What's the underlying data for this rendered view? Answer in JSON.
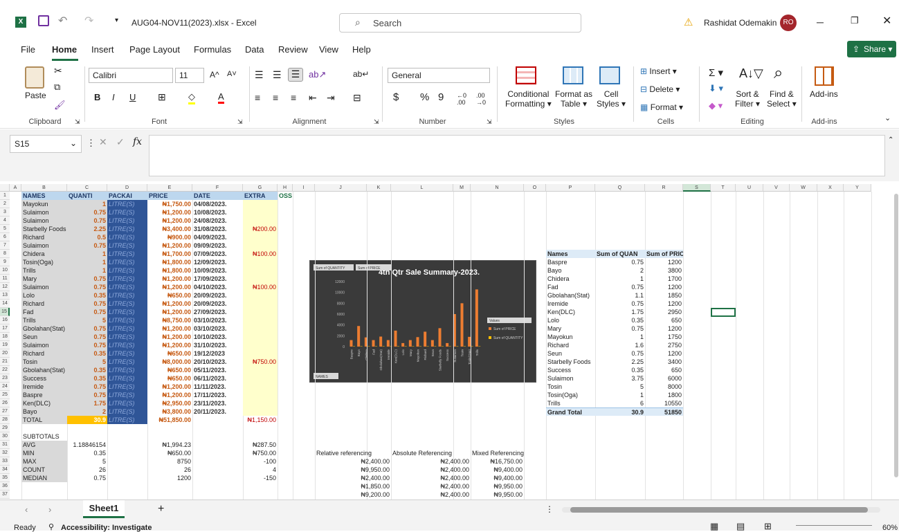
{
  "title_bar": {
    "app_icon": "X",
    "filename": "AUG04-NOV11(2023).xlsx",
    "app": "Excel",
    "sep": "-",
    "search_placeholder": "Search",
    "user": "Rashidat Odemakin",
    "initials": "RO"
  },
  "menus": [
    "File",
    "Home",
    "Insert",
    "Page Layout",
    "Formulas",
    "Data",
    "Review",
    "View",
    "Help"
  ],
  "share_label": "Share",
  "ribbon": {
    "clipboard": {
      "paste": "Paste",
      "label": "Clipboard"
    },
    "font": {
      "name": "Calibri",
      "size": "11",
      "bold": "B",
      "italic": "I",
      "underline": "U",
      "label": "Font",
      "grow": "A^",
      "shrink": "A˅"
    },
    "alignment": {
      "label": "Alignment"
    },
    "number": {
      "format": "General",
      "currency": "$",
      "percent": "%",
      "comma": "9",
      "label": "Number"
    },
    "styles": {
      "cond1": "Conditional",
      "cond2": "Formatting",
      "fmt1": "Format as",
      "fmt2": "Table",
      "cell1": "Cell",
      "cell2": "Styles",
      "label": "Styles"
    },
    "cells": {
      "insert": "Insert",
      "delete": "Delete",
      "format": "Format",
      "label": "Cells"
    },
    "editing": {
      "sort1": "Sort &",
      "sort2": "Filter",
      "find1": "Find &",
      "find2": "Select",
      "label": "Editing"
    },
    "addins": {
      "btn": "Add-ins",
      "label": "Add-ins"
    }
  },
  "formula_bar": {
    "name_box": "S15",
    "fx": "fx",
    "value": ""
  },
  "columns": [
    "A",
    "B",
    "C",
    "D",
    "E",
    "F",
    "G",
    "H",
    "I",
    "J",
    "K",
    "L",
    "M",
    "N",
    "O",
    "P",
    "Q",
    "R",
    "S",
    "T",
    "U",
    "V",
    "W",
    "X",
    "Y"
  ],
  "table_headers": [
    "NAMES",
    "QUANTI",
    "PACKAI",
    "PRICE",
    "DATE",
    "EXTRA",
    "OSS"
  ],
  "rows": [
    [
      "Mayokun",
      "1",
      "LITRE(S)",
      "₦1,750.00",
      "04/08/2023.",
      ""
    ],
    [
      "Sulaimon",
      "0.75",
      "LITRE(S)",
      "₦1,200.00",
      "10/08/2023.",
      ""
    ],
    [
      "Sulaimon",
      "0.75",
      "LITRE(S)",
      "₦1,200.00",
      "24/08/2023.",
      ""
    ],
    [
      "Starbelly Foods",
      "2.25",
      "LITRE(S)",
      "₦3,400.00",
      "31/08/2023.",
      "₦200.00"
    ],
    [
      "Richard",
      "0.5",
      "LITRE(S)",
      "₦900.00",
      "04/09/2023.",
      ""
    ],
    [
      "Sulaimon",
      "0.75",
      "LITRE(S)",
      "₦1,200.00",
      "09/09/2023.",
      ""
    ],
    [
      "Chidera",
      "1",
      "LITRE(S)",
      "₦1,700.00",
      "07/09/2023.",
      "₦100.00"
    ],
    [
      "Tosin(Oga)",
      "1",
      "LITRE(S)",
      "₦1,800.00",
      "12/09/2023.",
      ""
    ],
    [
      "Trills",
      "1",
      "LITRE(S)",
      "₦1,800.00",
      "10/09/2023.",
      ""
    ],
    [
      "Mary",
      "0.75",
      "LITRE(S)",
      "₦1,200.00",
      "17/09/2023.",
      ""
    ],
    [
      "Sulaimon",
      "0.75",
      "LITRE(S)",
      "₦1,200.00",
      "04/10/2023.",
      "₦100.00"
    ],
    [
      "Lolo",
      "0.35",
      "LITRE(S)",
      "₦650.00",
      "20/09/2023.",
      ""
    ],
    [
      "Richard",
      "0.75",
      "LITRE(S)",
      "₦1,200.00",
      "20/09/2023.",
      ""
    ],
    [
      "Fad",
      "0.75",
      "LITRE(S)",
      "₦1,200.00",
      "27/09/2023.",
      ""
    ],
    [
      "Trills",
      "5",
      "LITRE(S)",
      "₦8,750.00",
      "03/10/2023.",
      ""
    ],
    [
      "Gbolahan(Stat)",
      "0.75",
      "LITRE(S)",
      "₦1,200.00",
      "03/10/2023.",
      ""
    ],
    [
      "Seun",
      "0.75",
      "LITRE(S)",
      "₦1,200.00",
      "10/10/2023.",
      ""
    ],
    [
      "Sulaimon",
      "0.75",
      "LITRE(S)",
      "₦1,200.00",
      "31/10/2023.",
      ""
    ],
    [
      "Richard",
      "0.35",
      "LITRE(S)",
      "₦650.00",
      "19/12/2023",
      ""
    ],
    [
      "Tosin",
      "5",
      "LITRE(S)",
      "₦8,000.00",
      "20/10/2023.",
      "₦750.00"
    ],
    [
      "Gbolahan(Stat)",
      "0.35",
      "LITRE(S)",
      "₦650.00",
      "05/11/2023.",
      ""
    ],
    [
      "Success",
      "0.35",
      "LITRE(S)",
      "₦650.00",
      "06/11/2023.",
      ""
    ],
    [
      "Iremide",
      "0.75",
      "LITRE(S)",
      "₦1,200.00",
      "11/11/2023.",
      ""
    ],
    [
      "Baspre",
      "0.75",
      "LITRE(S)",
      "₦1,200.00",
      "17/11/2023.",
      ""
    ],
    [
      "Ken(DLC)",
      "1.75",
      "LITRE(S)",
      "₦2,950.00",
      "23/11/2023.",
      ""
    ],
    [
      "Bayo",
      "2",
      "LITRE(S)",
      "₦3,800.00",
      "20/11/2023.",
      ""
    ]
  ],
  "total_row": [
    "TOTAL",
    "30.9",
    "LITRE(S)",
    "₦51,850.00",
    "",
    "₦1,150.00"
  ],
  "subtotals": {
    "title": "SUBTOTALS",
    "rows": [
      [
        "AVG",
        "1.18846154",
        "₦1,994.23",
        "",
        "₦287.50"
      ],
      [
        "MIN",
        "0.35",
        "₦650.00",
        "",
        "₦750.00"
      ],
      [
        "MAX",
        "5",
        "8750",
        "",
        "-100"
      ],
      [
        "COUNT",
        "26",
        "26",
        "",
        "4"
      ],
      [
        "MEDIAN",
        "0.75",
        "1200",
        "",
        "-150"
      ]
    ]
  },
  "referencing": {
    "headers": [
      "Relative referencing",
      "Absolute Referencing",
      "Mixed Referencing"
    ],
    "rows": [
      [
        "₦2,400.00",
        "₦2,400.00",
        "₦16,750.00"
      ],
      [
        "₦9,950.00",
        "₦2,400.00",
        "₦9,400.00"
      ],
      [
        "₦2,400.00",
        "₦2,400.00",
        "₦9,400.00"
      ],
      [
        "₦1,850.00",
        "₦2,400.00",
        "₦9,950.00"
      ],
      [
        "₦9,200.00",
        "₦2,400.00",
        "₦9,950.00"
      ]
    ]
  },
  "pivot": {
    "headers": [
      "Names",
      "Sum of QUAN",
      "Sum of PRICE"
    ],
    "rows": [
      [
        "Baspre",
        "0.75",
        "1200"
      ],
      [
        "Bayo",
        "2",
        "3800"
      ],
      [
        "Chidera",
        "1",
        "1700"
      ],
      [
        "Fad",
        "0.75",
        "1200"
      ],
      [
        "Gbolahan(Stat)",
        "1.1",
        "1850"
      ],
      [
        "Iremide",
        "0.75",
        "1200"
      ],
      [
        "Ken(DLC)",
        "1.75",
        "2950"
      ],
      [
        "Lolo",
        "0.35",
        "650"
      ],
      [
        "Mary",
        "0.75",
        "1200"
      ],
      [
        "Mayokun",
        "1",
        "1750"
      ],
      [
        "Richard",
        "1.6",
        "2750"
      ],
      [
        "Seun",
        "0.75",
        "1200"
      ],
      [
        "Starbelly Foods",
        "2.25",
        "3400"
      ],
      [
        "Success",
        "0.35",
        "650"
      ],
      [
        "Sulaimon",
        "3.75",
        "6000"
      ],
      [
        "Tosin",
        "5",
        "8000"
      ],
      [
        "Tosin(Oga)",
        "1",
        "1800"
      ],
      [
        "Trills",
        "6",
        "10550"
      ]
    ],
    "total": [
      "Grand Total",
      "30.9",
      "51850"
    ]
  },
  "chart_data": {
    "type": "bar",
    "title": "4th Qtr Sale Summary-2023.",
    "buttons": [
      "Sum of QUANTITY",
      "Sum of PRICE"
    ],
    "filter_button": "NAMES",
    "legend_title": "Values",
    "categories": [
      "Baspre",
      "Bayo",
      "Chidera",
      "Fad",
      "Gbolahan(Stat)",
      "Iremide",
      "Ken(DLC)",
      "Lolo",
      "Mary",
      "Mayokun",
      "Richard",
      "Seun",
      "Starbelly Foods",
      "Success",
      "Sulaimon",
      "Tosin",
      "Tosin(Oga)",
      "Trills"
    ],
    "series": [
      {
        "name": "Sum of PRICE",
        "color": "#ed7d31",
        "values": [
          1200,
          3800,
          1700,
          1200,
          1850,
          1200,
          2950,
          650,
          1200,
          1750,
          2750,
          1200,
          3400,
          650,
          6000,
          8000,
          1800,
          10550
        ]
      },
      {
        "name": "Sum of QUANTITY",
        "color": "#ffc000",
        "values": [
          0.75,
          2,
          1,
          0.75,
          1.1,
          0.75,
          1.75,
          0.35,
          0.75,
          1,
          1.6,
          0.75,
          2.25,
          0.35,
          3.75,
          5,
          1,
          6
        ]
      }
    ],
    "yticks": [
      "0",
      "2000",
      "4000",
      "6000",
      "8000",
      "10000",
      "12000"
    ],
    "ylim": [
      0,
      12000
    ]
  },
  "sheet_tab": "Sheet1",
  "status": {
    "ready": "Ready",
    "accessibility": "Accessibility: Investigate",
    "zoom": "60%"
  }
}
